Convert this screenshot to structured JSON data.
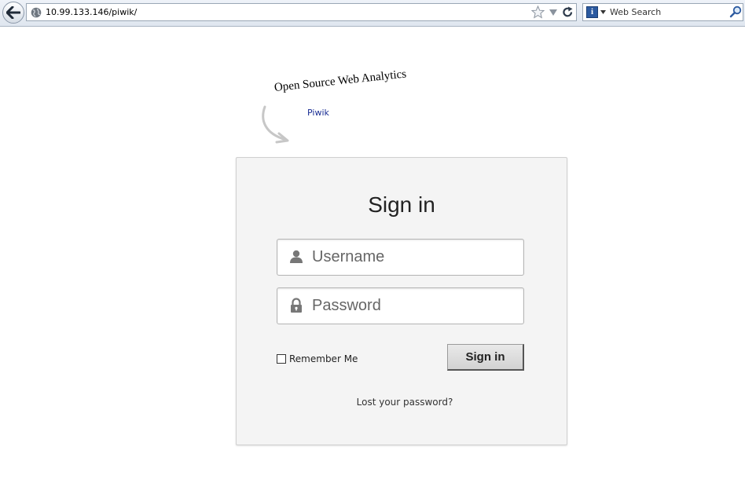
{
  "browser": {
    "url": "10.99.133.146/piwik/",
    "search_placeholder": "Web Search",
    "search_engine_icon": "info-i-icon"
  },
  "header": {
    "tagline": "Open Source Web Analytics",
    "brand": "Piwik"
  },
  "login": {
    "title": "Sign in",
    "username_placeholder": "Username",
    "password_placeholder": "Password",
    "remember_label": "Remember Me",
    "remember_checked": false,
    "submit_label": "Sign in",
    "lost_password": "Lost your password?"
  },
  "colors": {
    "card_bg": "#f4f4f4",
    "brand_blue": "#1a2e94"
  }
}
